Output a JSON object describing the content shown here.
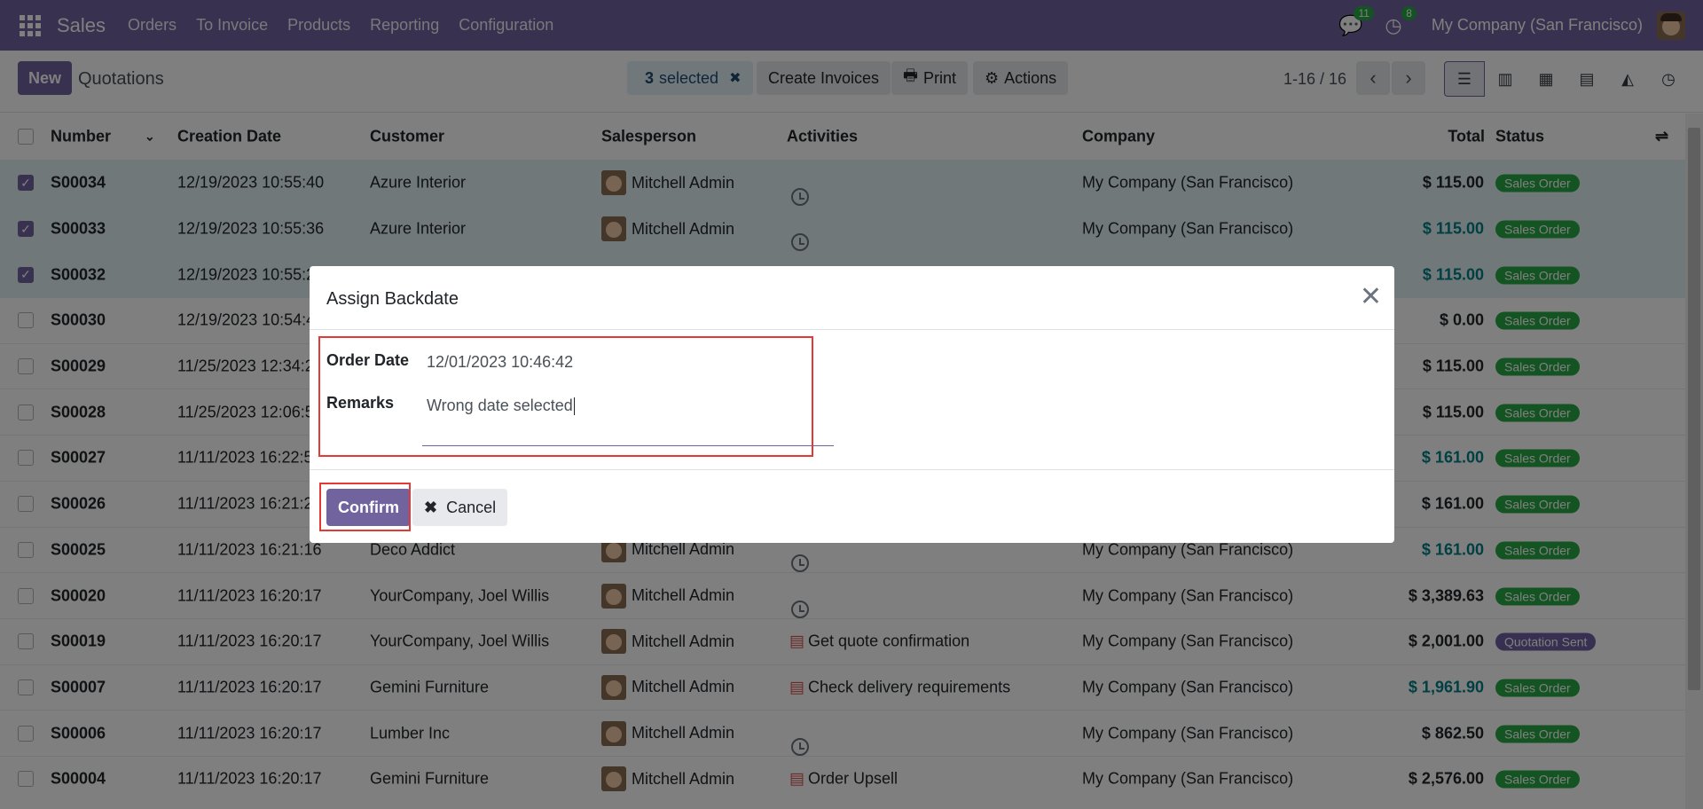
{
  "navbar": {
    "brand": "Sales",
    "menu": [
      "Orders",
      "To Invoice",
      "Products",
      "Reporting",
      "Configuration"
    ],
    "messages_count": "11",
    "activities_count": "8",
    "company": "My Company (San Francisco)"
  },
  "control_panel": {
    "new_label": "New",
    "breadcrumb": "Quotations",
    "selected_count": "3",
    "selected_label": "selected",
    "create_invoices_label": "Create Invoices",
    "print_label": "Print",
    "actions_label": "Actions",
    "pager": "1-16 / 16"
  },
  "table": {
    "headers": {
      "number": "Number",
      "creation_date": "Creation Date",
      "customer": "Customer",
      "salesperson": "Salesperson",
      "activities": "Activities",
      "company": "Company",
      "total": "Total",
      "status": "Status"
    },
    "rows": [
      {
        "number": "S00034",
        "date": "12/19/2023 10:55:40",
        "customer": "Azure Interior",
        "salesperson": "Mitchell Admin",
        "activity": "",
        "company": "My Company (San Francisco)",
        "total": "$ 115.00",
        "status": "Sales Order",
        "selected": true
      },
      {
        "number": "S00033",
        "date": "12/19/2023 10:55:36",
        "customer": "Azure Interior",
        "salesperson": "Mitchell Admin",
        "activity": "",
        "company": "My Company (San Francisco)",
        "total": "$ 115.00",
        "status": "Sales Order",
        "selected": true
      },
      {
        "number": "S00032",
        "date": "12/19/2023 10:55:2",
        "customer": "",
        "salesperson": "",
        "activity": "",
        "company": "",
        "total": "$ 115.00",
        "status": "Sales Order",
        "selected": true
      },
      {
        "number": "S00030",
        "date": "12/19/2023 10:54:4",
        "customer": "",
        "salesperson": "",
        "activity": "",
        "company": "",
        "total": "$ 0.00",
        "status": "Sales Order",
        "selected": false
      },
      {
        "number": "S00029",
        "date": "11/25/2023 12:34:2",
        "customer": "",
        "salesperson": "",
        "activity": "",
        "company": "",
        "total": "$ 115.00",
        "status": "Sales Order",
        "selected": false
      },
      {
        "number": "S00028",
        "date": "11/25/2023 12:06:5",
        "customer": "",
        "salesperson": "",
        "activity": "",
        "company": "",
        "total": "$ 115.00",
        "status": "Sales Order",
        "selected": false
      },
      {
        "number": "S00027",
        "date": "11/11/2023 16:22:5",
        "customer": "",
        "salesperson": "",
        "activity": "",
        "company": "",
        "total": "$ 161.00",
        "status": "Sales Order",
        "selected": false
      },
      {
        "number": "S00026",
        "date": "11/11/2023 16:21:2",
        "customer": "",
        "salesperson": "",
        "activity": "",
        "company": "",
        "total": "$ 161.00",
        "status": "Sales Order",
        "selected": false
      },
      {
        "number": "S00025",
        "date": "11/11/2023 16:21:16",
        "customer": "Deco Addict",
        "salesperson": "Mitchell Admin",
        "activity": "",
        "company": "My Company (San Francisco)",
        "total": "$ 161.00",
        "status": "Sales Order",
        "selected": false
      },
      {
        "number": "S00020",
        "date": "11/11/2023 16:20:17",
        "customer": "YourCompany, Joel Willis",
        "salesperson": "Mitchell Admin",
        "activity": "",
        "company": "My Company (San Francisco)",
        "total": "$ 3,389.63",
        "status": "Sales Order",
        "selected": false
      },
      {
        "number": "S00019",
        "date": "11/11/2023 16:20:17",
        "customer": "YourCompany, Joel Willis",
        "salesperson": "Mitchell Admin",
        "activity": "Get quote confirmation",
        "company": "My Company (San Francisco)",
        "total": "$ 2,001.00",
        "status": "Quotation Sent",
        "selected": false
      },
      {
        "number": "S00007",
        "date": "11/11/2023 16:20:17",
        "customer": "Gemini Furniture",
        "salesperson": "Mitchell Admin",
        "activity": "Check delivery requirements",
        "company": "My Company (San Francisco)",
        "total": "$ 1,961.90",
        "status": "Sales Order",
        "selected": false
      },
      {
        "number": "S00006",
        "date": "11/11/2023 16:20:17",
        "customer": "Lumber Inc",
        "salesperson": "Mitchell Admin",
        "activity": "",
        "company": "My Company (San Francisco)",
        "total": "$ 862.50",
        "status": "Sales Order",
        "selected": false
      },
      {
        "number": "S00004",
        "date": "11/11/2023 16:20:17",
        "customer": "Gemini Furniture",
        "salesperson": "Mitchell Admin",
        "activity": "Order Upsell",
        "company": "My Company (San Francisco)",
        "total": "$ 2,576.00",
        "status": "Sales Order",
        "selected": false
      }
    ]
  },
  "dialog": {
    "title": "Assign Backdate",
    "order_date_label": "Order Date",
    "order_date_value": "12/01/2023 10:46:42",
    "remarks_label": "Remarks",
    "remarks_value": "Wrong date selected",
    "confirm_label": "Confirm",
    "cancel_label": "Cancel"
  },
  "colors": {
    "brand": "#71639e",
    "status_green": "#28a745",
    "highlight_red": "#e53935",
    "teal_total": "#017e84"
  }
}
